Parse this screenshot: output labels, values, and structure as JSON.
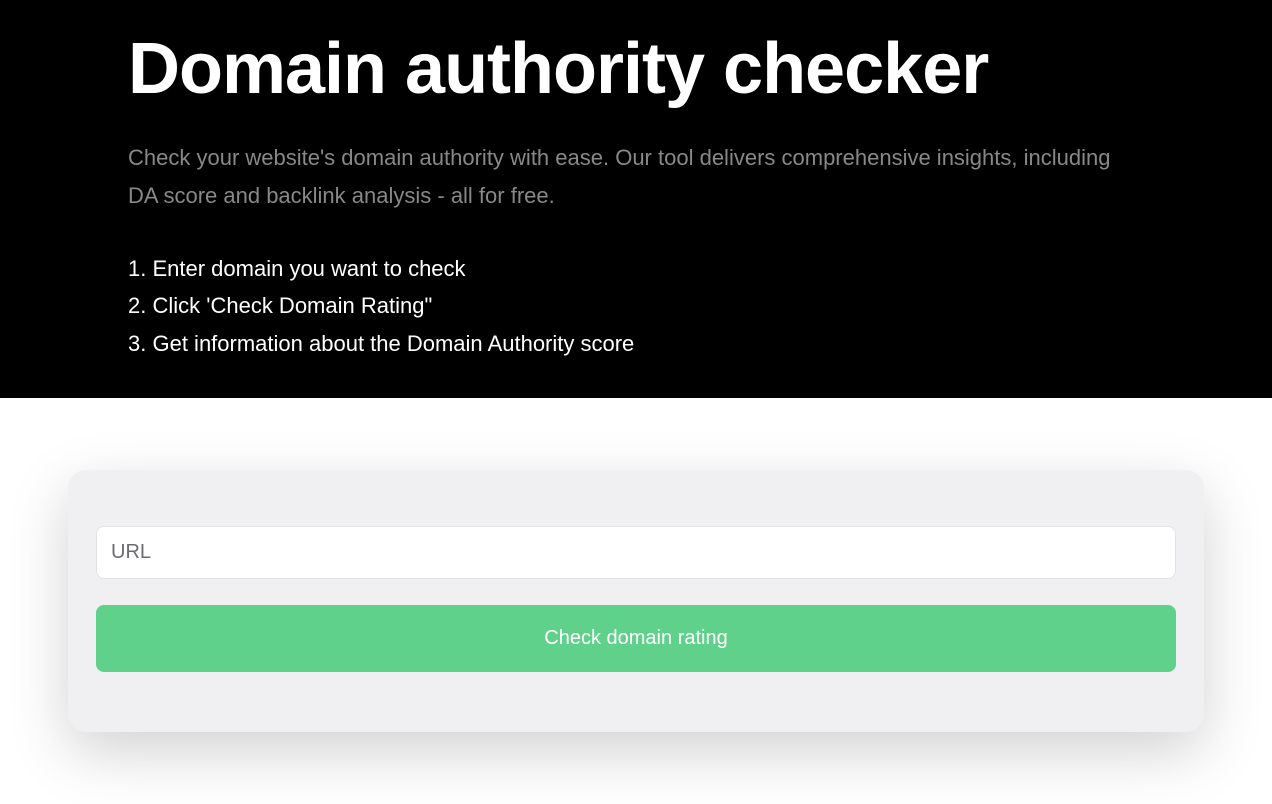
{
  "hero": {
    "title": "Domain authority checker",
    "subtitle": "Check your website's domain authority with ease. Our tool delivers comprehensive insights, including DA score and backlink analysis - all for free.",
    "steps": [
      "Enter domain you want to check",
      "Click 'Check Domain Rating\"",
      "Get information about the Domain Authority score"
    ]
  },
  "form": {
    "url_placeholder": "URL",
    "url_value": "",
    "button_label": "Check domain rating"
  },
  "colors": {
    "accent": "#5fd18b",
    "hero_bg": "#000000",
    "card_bg": "#f0f0f2"
  }
}
